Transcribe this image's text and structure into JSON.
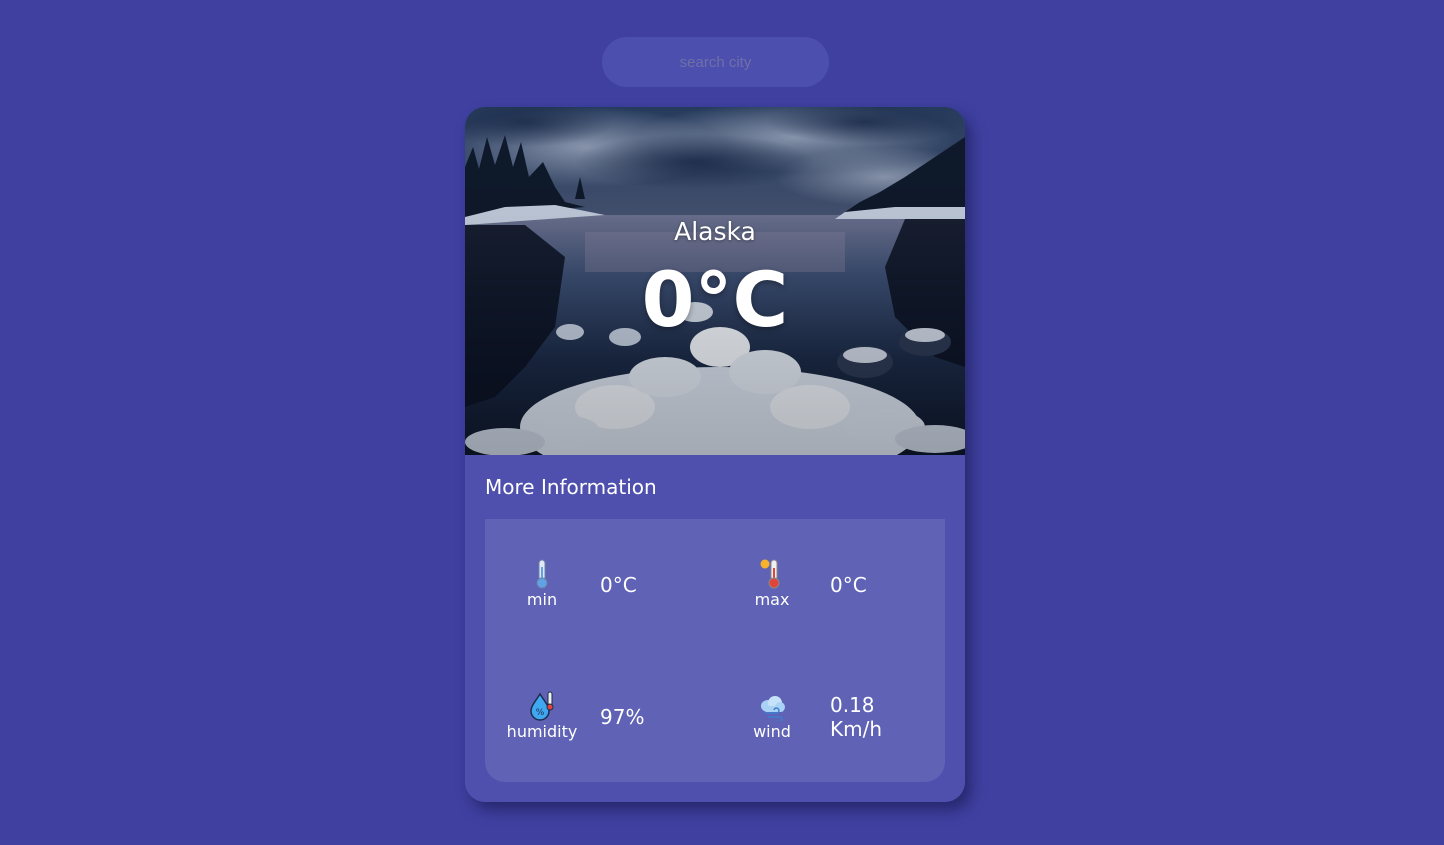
{
  "search": {
    "placeholder": "search city",
    "value": ""
  },
  "weather": {
    "city": "Alaska",
    "temperature": "0°C"
  },
  "more_info": {
    "title": "More Information",
    "min": {
      "label": "min",
      "value": "0°C",
      "icon": "thermometer-cold-icon"
    },
    "max": {
      "label": "max",
      "value": "0°C",
      "icon": "thermometer-hot-icon"
    },
    "humidity": {
      "label": "humidity",
      "value": "97%",
      "icon": "humidity-drop-icon"
    },
    "wind": {
      "label": "wind",
      "value": "0.18 Km/h",
      "icon": "wind-cloud-icon"
    }
  },
  "colors": {
    "background": "#3f40a0",
    "card": "#4f50ad",
    "panel": "#5f62b5",
    "search": "#4c4fae"
  }
}
